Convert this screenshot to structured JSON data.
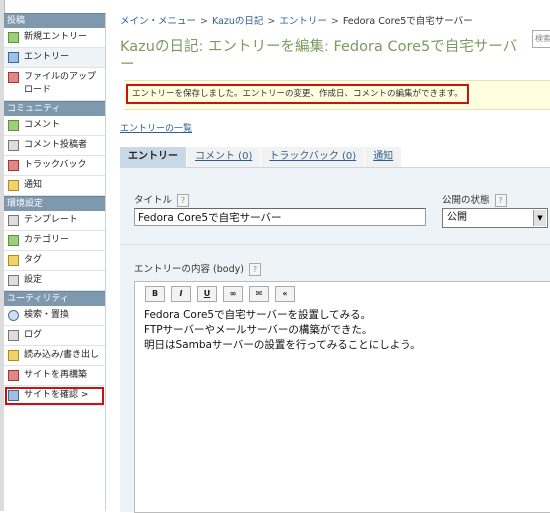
{
  "sidebar": {
    "sections": [
      {
        "title": "投稿",
        "items": [
          {
            "label": "新規エントリー",
            "icon": "new-entry-icon"
          },
          {
            "label": "エントリー",
            "icon": "entry-icon"
          },
          {
            "label": "ファイルのアップロード",
            "icon": "file-upload-icon"
          }
        ]
      },
      {
        "title": "コミュニティ",
        "items": [
          {
            "label": "コメント",
            "icon": "comment-icon"
          },
          {
            "label": "コメント投稿者",
            "icon": "commenter-icon"
          },
          {
            "label": "トラックバック",
            "icon": "trackback-icon"
          },
          {
            "label": "通知",
            "icon": "notification-icon"
          }
        ]
      },
      {
        "title": "環境設定",
        "items": [
          {
            "label": "テンプレート",
            "icon": "template-icon"
          },
          {
            "label": "カテゴリー",
            "icon": "category-icon"
          },
          {
            "label": "タグ",
            "icon": "tag-icon"
          },
          {
            "label": "設定",
            "icon": "settings-icon"
          }
        ]
      },
      {
        "title": "ユーティリティ",
        "items": [
          {
            "label": "検索・置換",
            "icon": "search-icon"
          },
          {
            "label": "ログ",
            "icon": "log-icon"
          },
          {
            "label": "読み込み/書き出し",
            "icon": "import-export-icon"
          },
          {
            "label": "サイトを再構築",
            "icon": "rebuild-icon"
          },
          {
            "label": "サイトを確認 >",
            "icon": "view-site-icon"
          }
        ]
      }
    ]
  },
  "breadcrumb": {
    "items": [
      "メイン・メニュー",
      "Kazuの日記",
      "エントリー",
      "Fedora Core5で自宅サーバー"
    ],
    "separator": ">"
  },
  "search": {
    "placeholder": "検索"
  },
  "page_title": {
    "blog": "Kazuの日記",
    "action": "エントリーを編集",
    "entry": "Fedora Core5で自宅サーバー"
  },
  "message": "エントリーを保存しました。エントリーの変更、作成日、コメントの編集ができます。",
  "entry_list_link": "エントリーの一覧",
  "tabs": [
    "エントリー",
    "コメント (0)",
    "トラックバック (0)",
    "通知"
  ],
  "form": {
    "title_label": "タイトル",
    "title_value": "Fedora Core5で自宅サーバー",
    "status_label": "公開の状態",
    "status_value": "公開",
    "body_label": "エントリーの内容 (body)",
    "help": "?",
    "toolbar": [
      "B",
      "I",
      "U",
      "∞",
      "✉",
      "«"
    ],
    "body_lines": [
      "Fedora Core5で自宅サーバーを設置してみる。",
      "FTPサーバーやメールサーバーの構築ができた。",
      "明日はSambaサーバーの設置を行ってみることにしよう。"
    ]
  }
}
